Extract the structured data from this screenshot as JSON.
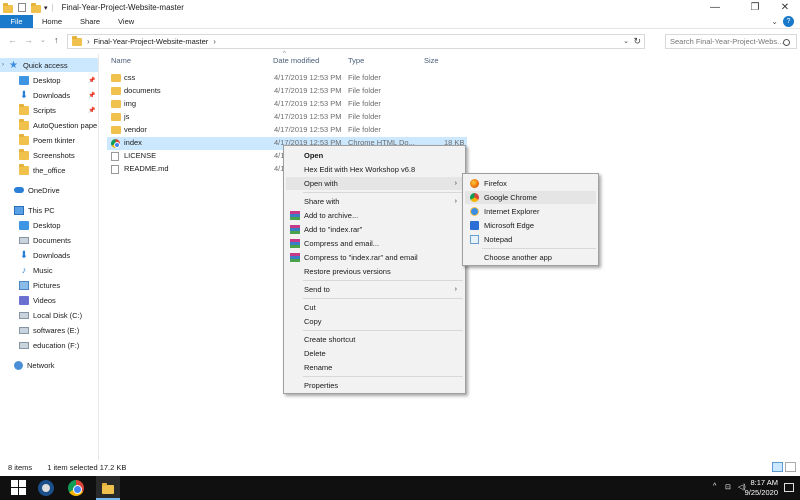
{
  "window": {
    "title": "Final-Year-Project-Website-master",
    "minimize": "—",
    "maximize": "❐",
    "close": "✕"
  },
  "ribbon": {
    "file": "File",
    "tabs": [
      "Home",
      "Share",
      "View"
    ]
  },
  "address": {
    "crumb": "Final-Year-Project-Website-master",
    "separator": "›"
  },
  "search": {
    "placeholder": "Search Final-Year-Project-Webs..."
  },
  "nav": {
    "quick_access": "Quick access",
    "items": [
      {
        "label": "Desktop",
        "pinned": true
      },
      {
        "label": "Downloads",
        "pinned": true
      },
      {
        "label": "Scripts",
        "pinned": true
      },
      {
        "label": "AutoQuestion pape",
        "pinned": false
      },
      {
        "label": "Poem tkinter",
        "pinned": false
      },
      {
        "label": "Screenshots",
        "pinned": false
      },
      {
        "label": "the_office",
        "pinned": false
      }
    ],
    "onedrive": "OneDrive",
    "this_pc": "This PC",
    "pc_items": [
      "Desktop",
      "Documents",
      "Downloads",
      "Music",
      "Pictures",
      "Videos",
      "Local Disk (C:)",
      "softwares (E:)",
      "education (F:)"
    ],
    "network": "Network"
  },
  "columns": {
    "name": "Name",
    "date": "Date modified",
    "type": "Type",
    "size": "Size"
  },
  "files": [
    {
      "name": "css",
      "date": "4/17/2019 12:53 PM",
      "type": "File folder",
      "size": ""
    },
    {
      "name": "documents",
      "date": "4/17/2019 12:53 PM",
      "type": "File folder",
      "size": ""
    },
    {
      "name": "img",
      "date": "4/17/2019 12:53 PM",
      "type": "File folder",
      "size": ""
    },
    {
      "name": "js",
      "date": "4/17/2019 12:53 PM",
      "type": "File folder",
      "size": ""
    },
    {
      "name": "vendor",
      "date": "4/17/2019 12:53 PM",
      "type": "File folder",
      "size": ""
    },
    {
      "name": "index",
      "date": "4/17/2019 12:53 PM",
      "type": "Chrome HTML Do...",
      "size": "18 KB"
    },
    {
      "name": "LICENSE",
      "date": "4/1",
      "type": "",
      "size": ""
    },
    {
      "name": "README.md",
      "date": "4/1",
      "type": "",
      "size": ""
    }
  ],
  "status": {
    "count": "8 items",
    "selection": "1 item selected  17.2 KB"
  },
  "context_menu": {
    "open": "Open",
    "hex_edit": "Hex Edit with Hex Workshop v6.8",
    "open_with": "Open with",
    "share_with": "Share with",
    "add_archive": "Add to archive...",
    "add_rar": "Add to \"index.rar\"",
    "compress_email": "Compress and email...",
    "compress_rar_email": "Compress to \"index.rar\" and email",
    "restore": "Restore previous versions",
    "send_to": "Send to",
    "cut": "Cut",
    "copy": "Copy",
    "create_shortcut": "Create shortcut",
    "delete": "Delete",
    "rename": "Rename",
    "properties": "Properties",
    "arrow": "›"
  },
  "open_with_menu": {
    "firefox": "Firefox",
    "chrome": "Google Chrome",
    "ie": "Internet Explorer",
    "edge": "Microsoft Edge",
    "notepad": "Notepad",
    "another": "Choose another app"
  },
  "taskbar": {
    "time": "8:17 AM",
    "date": "9/25/2020",
    "tray_chevron": "^",
    "tray_network": "⊡",
    "tray_volume": "◁)"
  }
}
